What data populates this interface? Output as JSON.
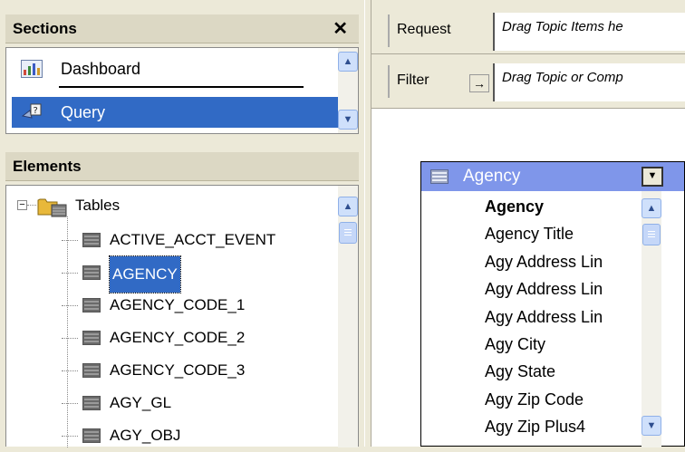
{
  "sections": {
    "title": "Sections",
    "close_glyph": "✕",
    "items": [
      {
        "label": "Dashboard",
        "icon": "dashboard-icon",
        "selected": false
      },
      {
        "label": "Query",
        "icon": "query-icon",
        "selected": true
      }
    ]
  },
  "elements": {
    "title": "Elements",
    "tree_root": "Tables",
    "tables": [
      "ACTIVE_ACCT_EVENT",
      "AGENCY",
      "AGENCY_CODE_1",
      "AGENCY_CODE_2",
      "AGENCY_CODE_3",
      "AGY_GL",
      "AGY_OBJ"
    ],
    "selected_table": "AGENCY"
  },
  "request": {
    "label": "Request",
    "placeholder": "Drag Topic Items he"
  },
  "filter": {
    "label": "Filter",
    "placeholder": "Drag Topic or Comp"
  },
  "topic": {
    "title": "Agency",
    "fields": [
      "Agency",
      "Agency Title",
      "Agy Address Lin",
      "Agy Address Lin",
      "Agy Address Lin",
      "Agy City",
      "Agy State",
      "Agy Zip Code",
      "Agy Zip Plus4"
    ],
    "bold_field": "Agency"
  },
  "colors": {
    "selection": "#316ac5",
    "topic_header": "#7f96ea"
  }
}
